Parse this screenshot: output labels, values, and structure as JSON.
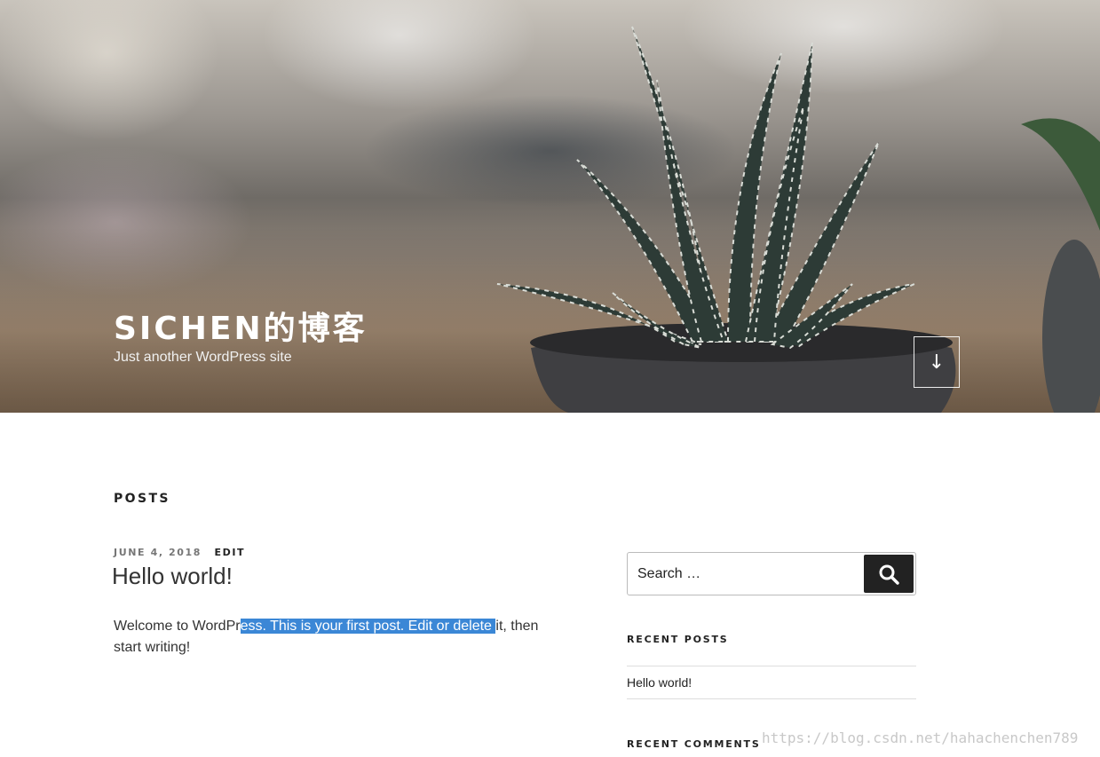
{
  "header": {
    "site_title": "SICHEN的博客",
    "site_description": "Just another WordPress site",
    "scroll_down_glyph": "↓"
  },
  "main": {
    "page_heading": "POSTS",
    "post": {
      "date": "JUNE 4, 2018",
      "edit_label": "EDIT",
      "title": "Hello world!",
      "content_before": "Welcome to WordPr",
      "content_selected": "ess. This is your first post. Edit or delete ",
      "content_after": "it, then start writing!"
    }
  },
  "sidebar": {
    "search": {
      "placeholder": "Search …",
      "button_icon": "search-icon"
    },
    "recent_posts": {
      "title": "RECENT POSTS",
      "items": [
        "Hello world!"
      ]
    },
    "recent_comments": {
      "title": "RECENT COMMENTS"
    }
  },
  "watermark": "https://blog.csdn.net/hahachenchen789",
  "colors": {
    "selection": "#3b87d6",
    "search_button": "#222222",
    "text": "#222222"
  }
}
